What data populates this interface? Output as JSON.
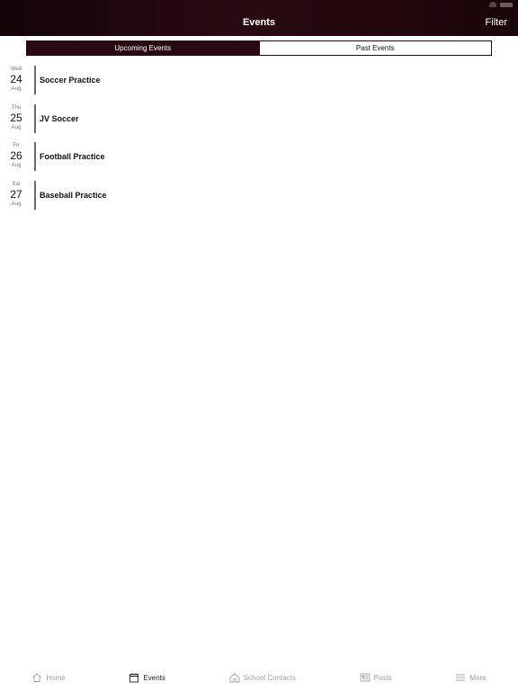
{
  "app": {
    "title": "Events",
    "filter_label": "Filter"
  },
  "segments": {
    "upcoming": "Upcoming Events",
    "past": "Past Events"
  },
  "events": [
    {
      "dow": "Wed",
      "day": "24",
      "month": "Aug",
      "title": "Soccer Practice"
    },
    {
      "dow": "Thu",
      "day": "25",
      "month": "Aug",
      "title": "JV Soccer"
    },
    {
      "dow": "Fri",
      "day": "26",
      "month": "Aug",
      "title": "Football Practice"
    },
    {
      "dow": "Sat",
      "day": "27",
      "month": "Aug",
      "title": "Baseball Practice"
    }
  ],
  "tabs": [
    {
      "label": "Home",
      "icon": "home-icon",
      "active": false
    },
    {
      "label": "Events",
      "icon": "calendar-icon",
      "active": true
    },
    {
      "label": "School Contacts",
      "icon": "school-icon",
      "active": false
    },
    {
      "label": "Posts",
      "icon": "news-icon",
      "active": false
    },
    {
      "label": "More",
      "icon": "menu-icon",
      "active": false
    }
  ],
  "colors": {
    "nav_bg": "#2a0a12",
    "accent": "#2a0a12",
    "tab_inactive": "#a0a0a0",
    "tab_active": "#222222"
  }
}
